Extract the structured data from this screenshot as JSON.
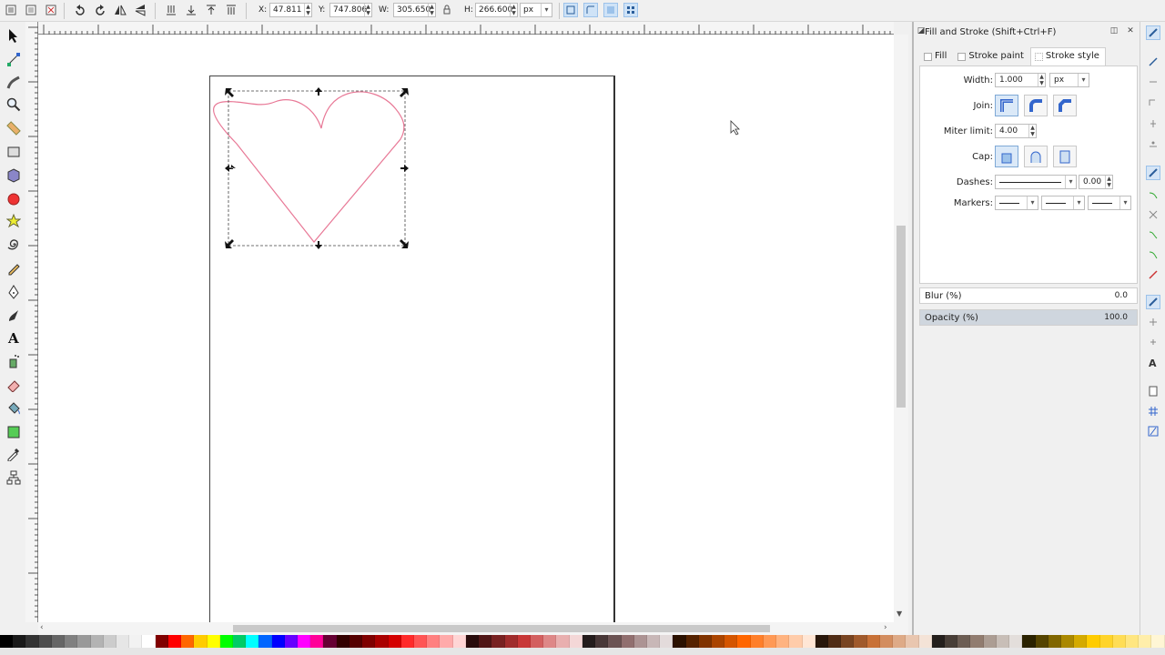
{
  "toolbar": {
    "x_label": "X:",
    "x_value": "47.811",
    "y_label": "Y:",
    "y_value": "747.806",
    "w_label": "W:",
    "w_value": "305.650",
    "h_label": "H:",
    "h_value": "266.600",
    "unit": "px"
  },
  "dock": {
    "title": "Fill and Stroke (Shift+Ctrl+F)",
    "tabs": [
      {
        "label": "Fill"
      },
      {
        "label": "Stroke paint"
      },
      {
        "label": "Stroke style"
      }
    ],
    "stroke_style": {
      "width_label": "Width:",
      "width_value": "1.000",
      "width_unit": "px",
      "join_label": "Join:",
      "miter_label": "Miter limit:",
      "miter_value": "4.00",
      "cap_label": "Cap:",
      "dashes_label": "Dashes:",
      "dashes_offset": "0.00",
      "markers_label": "Markers:"
    },
    "blur_label": "Blur (%)",
    "blur_value": "0.0",
    "blur_fraction": 0.0,
    "opacity_label": "Opacity (%)",
    "opacity_value": "100.0",
    "opacity_fraction": 1.0
  },
  "canvas": {
    "stroke_color": "#e87896",
    "selection_color": "#444444"
  },
  "palette": [
    "#000000",
    "#1a1a1a",
    "#333333",
    "#4d4d4d",
    "#666666",
    "#808080",
    "#999999",
    "#b3b3b3",
    "#cccccc",
    "#e6e6e6",
    "#f2f2f2",
    "#ffffff",
    "#800000",
    "#ff0000",
    "#ff6600",
    "#ffcc00",
    "#ffff00",
    "#00ff00",
    "#00cc66",
    "#00ffff",
    "#0066ff",
    "#0000ff",
    "#6600ff",
    "#ff00ff",
    "#ff0099",
    "#660033",
    "#330000",
    "#550000",
    "#7f0000",
    "#aa0000",
    "#d40000",
    "#ff2a2a",
    "#ff5555",
    "#ff8080",
    "#ffaaaa",
    "#ffd5d5",
    "#280b0b",
    "#501616",
    "#782121",
    "#a02c2c",
    "#c83737",
    "#d35f5f",
    "#de8787",
    "#e9afaf",
    "#f4d7d7",
    "#241c1c",
    "#483737",
    "#6c5353",
    "#916f6f",
    "#ac9393",
    "#c8b7b7",
    "#e3dbdb",
    "#2b1100",
    "#552200",
    "#803300",
    "#aa4400",
    "#d45500",
    "#ff6600",
    "#ff7f2a",
    "#ff9955",
    "#ffb380",
    "#ffccaa",
    "#ffe6d5",
    "#28170b",
    "#502d16",
    "#784421",
    "#a05a2c",
    "#c87137",
    "#d38d5f",
    "#deaa87",
    "#e9c6af",
    "#f4e3d7",
    "#241f1c",
    "#483e37",
    "#6c5d53",
    "#917c6f",
    "#ac9d93",
    "#c8beb7",
    "#e3dedb",
    "#2b2200",
    "#554400",
    "#806600",
    "#aa8800",
    "#d4aa00",
    "#ffcc00",
    "#ffd42a",
    "#ffdd55",
    "#ffe680",
    "#ffeeaa",
    "#fff6d5"
  ],
  "tooltips": {}
}
